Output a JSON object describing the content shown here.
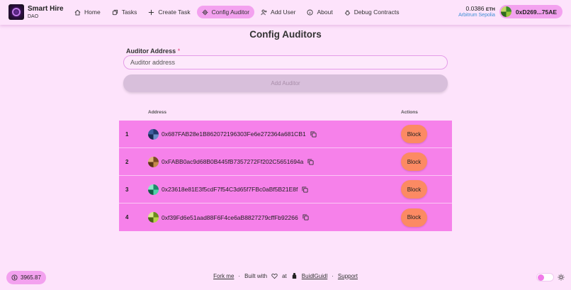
{
  "brand": {
    "title": "Smart Hire",
    "subtitle": "DAO"
  },
  "nav": [
    {
      "label": "Home",
      "icon": "home-icon",
      "active": false
    },
    {
      "label": "Tasks",
      "icon": "tasks-icon",
      "active": false
    },
    {
      "label": "Create Task",
      "icon": "plus-icon",
      "active": false
    },
    {
      "label": "Config Auditor",
      "icon": "gear-icon",
      "active": true
    },
    {
      "label": "Add User",
      "icon": "add-user-icon",
      "active": false
    },
    {
      "label": "About",
      "icon": "info-icon",
      "active": false
    },
    {
      "label": "Debug Contracts",
      "icon": "bug-icon",
      "active": false
    }
  ],
  "wallet": {
    "balance": "0.0386",
    "symbol": "ETH",
    "network": "Arbitrum Sepolia",
    "account": "0xD269...75AE"
  },
  "page": {
    "title": "Config Auditors"
  },
  "form": {
    "label": "Auditor Address",
    "required_mark": "*",
    "placeholder": "Auditor address",
    "add_button": "Add Auditor"
  },
  "table": {
    "headers": {
      "address": "Address",
      "actions": "Actions"
    },
    "rows": [
      {
        "index": "1",
        "address": "0x687FAB28e1B862072196303Fe6e272364a681CB1",
        "action": "Block"
      },
      {
        "index": "2",
        "address": "0xFABB0ac9d68B0B445fB7357272Ff202C5651694a",
        "action": "Block"
      },
      {
        "index": "3",
        "address": "0x23618e81E3f5cdF7f54C3d65f7FBc0aBf5B21E8f",
        "action": "Block"
      },
      {
        "index": "4",
        "address": "0xf39Fd6e51aad88F6F4ce6aB8827279cffFb92266",
        "action": "Block"
      }
    ]
  },
  "footer": {
    "faucet_value": "3965.87",
    "fork_me": "Fork me",
    "built_with": "Built with",
    "at": "at",
    "buidlguidl": "BuidlGuidl",
    "support": "Support",
    "separator": "·"
  },
  "colors": {
    "background": "#fde3fb",
    "accent": "#f3a1ef",
    "row": "#f681ea",
    "block_button": "#fc8a63"
  }
}
